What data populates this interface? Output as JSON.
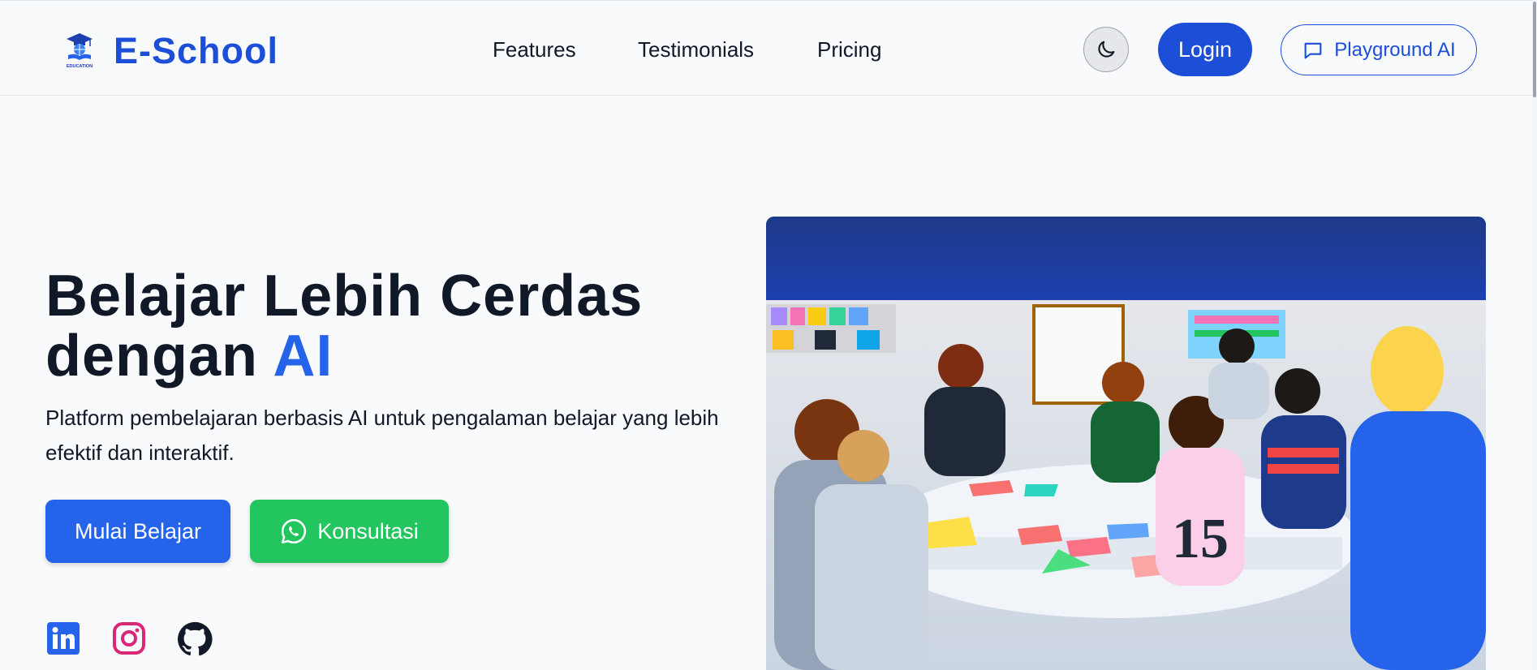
{
  "brand": {
    "name": "E-School",
    "logo_caption": "EDUCATION",
    "color": "#1d4ed8"
  },
  "nav": {
    "links": [
      "Features",
      "Testimonials",
      "Pricing"
    ]
  },
  "actions": {
    "theme_icon": "moon-icon",
    "login_label": "Login",
    "playground_label": "Playground AI",
    "playground_icon": "chat-bubble-icon"
  },
  "hero": {
    "title_line1": "Belajar Lebih Cerdas",
    "title_line2_prefix": "dengan",
    "title_line2_accent": "AI",
    "subtitle": "Platform pembelajaran berbasis AI untuk pengalaman belajar yang lebih efektif dan interaktif.",
    "primary_button": "Mulai Belajar",
    "secondary_button": "Konsultasi",
    "accent_color": "#2563eb",
    "whatsapp_color": "#22c55e"
  },
  "social": {
    "icons": [
      "linkedin-icon",
      "instagram-icon",
      "github-icon"
    ]
  },
  "image": {
    "description_icon": "classroom-photo"
  }
}
